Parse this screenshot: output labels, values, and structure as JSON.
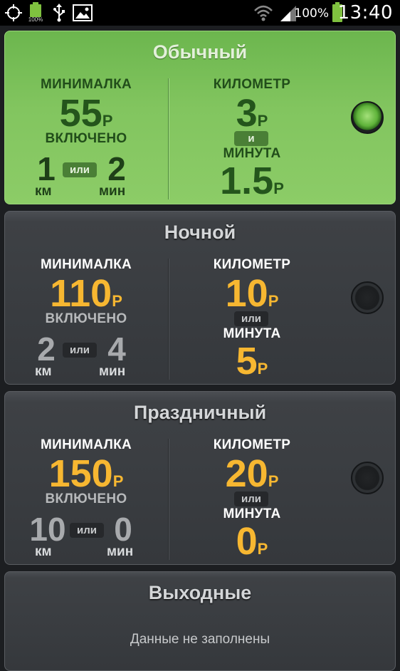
{
  "status": {
    "battery_percent": "100%",
    "time": "13:40",
    "battery_icon_label": "100%"
  },
  "labels": {
    "minimum": "МИНИМАЛКА",
    "included": "ВКЛЮЧЕНО",
    "kilometer": "КИЛОМЕТР",
    "minute": "МИНУТА",
    "km": "км",
    "min": "мин",
    "or": "или",
    "currency": "Р"
  },
  "tariffs": [
    {
      "title": "Обычный",
      "active": true,
      "minimum": "55",
      "included_km": "1",
      "included_min": "2",
      "per_km": "3",
      "connector": "и",
      "per_minute": "1.5"
    },
    {
      "title": "Ночной",
      "active": false,
      "minimum": "110",
      "included_km": "2",
      "included_min": "4",
      "per_km": "10",
      "connector": "или",
      "per_minute": "5"
    },
    {
      "title": "Праздничный",
      "active": false,
      "minimum": "150",
      "included_km": "10",
      "included_min": "0",
      "per_km": "20",
      "connector": "или",
      "per_minute": "0"
    },
    {
      "title": "Выходные",
      "active": false,
      "placeholder": "Данные не заполнены"
    }
  ]
}
